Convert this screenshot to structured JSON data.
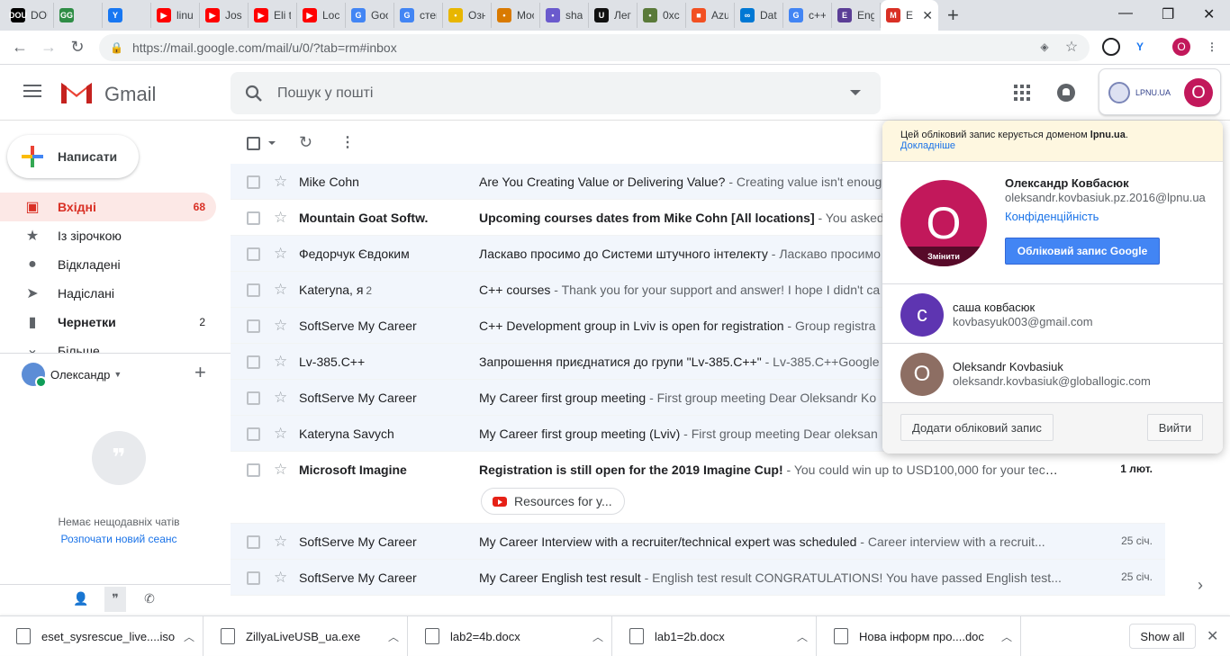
{
  "browser": {
    "tabs": [
      {
        "title": "DOU",
        "fav_color": "#000000",
        "fav_text": "DOU"
      },
      {
        "title": "",
        "fav_color": "#2f8d46",
        "fav_text": "GG"
      },
      {
        "title": "",
        "fav_color": "#1877f2",
        "fav_text": "Y"
      },
      {
        "title": "linux",
        "fav_color": "#ff0000",
        "fav_text": "▶"
      },
      {
        "title": "Jose",
        "fav_color": "#ff0000",
        "fav_text": "▶"
      },
      {
        "title": "Eli th",
        "fav_color": "#ff0000",
        "fav_text": "▶"
      },
      {
        "title": "Loca",
        "fav_color": "#ff0000",
        "fav_text": "▶"
      },
      {
        "title": "Goo",
        "fav_color": "#4285f4",
        "fav_text": "G"
      },
      {
        "title": "стек",
        "fav_color": "#4285f4",
        "fav_text": "G"
      },
      {
        "title": "Озн",
        "fav_color": "#e8b600",
        "fav_text": "•"
      },
      {
        "title": "Moc",
        "fav_color": "#d97a00",
        "fav_text": "•"
      },
      {
        "title": "shar",
        "fav_color": "#6a5acd",
        "fav_text": "•"
      },
      {
        "title": "Леге",
        "fav_color": "#111111",
        "fav_text": "U"
      },
      {
        "title": "0xc0",
        "fav_color": "#5a7a3a",
        "fav_text": "•"
      },
      {
        "title": "Azur",
        "fav_color": "#f25022",
        "fav_text": "■"
      },
      {
        "title": "Data",
        "fav_color": "#0078d4",
        "fav_text": "∞"
      },
      {
        "title": "c++",
        "fav_color": "#4285f4",
        "fav_text": "G"
      },
      {
        "title": "Engl",
        "fav_color": "#5b3e96",
        "fav_text": "E"
      }
    ],
    "active_tab": {
      "title": "E",
      "fav_color": "#d93025",
      "fav_text": "M"
    },
    "url": "https://mail.google.com/mail/u/0/?tab=rm#inbox",
    "profile_initial": "O"
  },
  "gmail": {
    "logo_text": "Gmail",
    "search_placeholder": "Пошук у пошті",
    "compose_label": "Написати",
    "nav": [
      {
        "label": "Вхідні",
        "count": "68",
        "icon": "inbox-icon",
        "glyph": "▣",
        "active": true,
        "bold": true
      },
      {
        "label": "Із зірочкою",
        "count": "",
        "icon": "star-icon",
        "glyph": "★",
        "active": false,
        "bold": false
      },
      {
        "label": "Відкладені",
        "count": "",
        "icon": "clock-icon",
        "glyph": "●",
        "active": false,
        "bold": false
      },
      {
        "label": "Надіслані",
        "count": "",
        "icon": "send-icon",
        "glyph": "➤",
        "active": false,
        "bold": false
      },
      {
        "label": "Чернетки",
        "count": "2",
        "icon": "draft-icon",
        "glyph": "▮",
        "active": false,
        "bold": true
      }
    ],
    "nav_more": "Більше",
    "hangouts": {
      "user": "Олександр",
      "empty_text": "Немає нещодавніх чатів",
      "new_session": "Розпочати новий сеанс"
    },
    "emails": [
      {
        "from": "Mike Cohn",
        "count": "",
        "subject": "Are You Creating Value or Delivering Value?",
        "snippet": " - Creating value isn't enough",
        "date": "",
        "unread": false,
        "chip": ""
      },
      {
        "from": "Mountain Goat Softw.",
        "count": "",
        "subject": "Upcoming courses dates from Mike Cohn [All locations]",
        "snippet": " - You asked to",
        "date": "",
        "unread": true,
        "chip": ""
      },
      {
        "from": "Федорчук Євдоким",
        "count": "",
        "subject": "Ласкаво просимо до Системи штучного інтелекту",
        "snippet": " - Ласкаво просимо",
        "date": "",
        "unread": false,
        "chip": ""
      },
      {
        "from": "Kateryna, я",
        "count": "2",
        "subject": "C++ courses",
        "snippet": " - Thank you for your support and answer! I hope I didn't ca",
        "date": "",
        "unread": false,
        "chip": ""
      },
      {
        "from": "SoftServe My Career",
        "count": "",
        "subject": "C++ Development group in Lviv is open for registration",
        "snippet": " - Group registra",
        "date": "",
        "unread": false,
        "chip": ""
      },
      {
        "from": "Lv-385.C++",
        "count": "",
        "subject": "Запрошення приєднатися до групи \"Lv-385.C++\"",
        "snippet": " - Lv-385.C++Google",
        "date": "",
        "unread": false,
        "chip": ""
      },
      {
        "from": "SoftServe My Career",
        "count": "",
        "subject": "My Career first group meeting",
        "snippet": " - First group meeting Dear Oleksandr Ko",
        "date": "",
        "unread": false,
        "chip": ""
      },
      {
        "from": "Kateryna Savych",
        "count": "",
        "subject": "My Career first group meeting (Lviv)",
        "snippet": " - First group meeting Dear oleksan",
        "date": "",
        "unread": false,
        "chip": ""
      },
      {
        "from": "Microsoft Imagine",
        "count": "",
        "subject": "Registration is still open for the 2019 Imagine Cup!",
        "snippet": " - You could win up to USD100,000 for your tech i...",
        "date": "1 лют.",
        "unread": true,
        "chip": "Resources for y..."
      },
      {
        "from": "SoftServe My Career",
        "count": "",
        "subject": "My Career Interview with a recruiter/technical expert was scheduled",
        "snippet": " - Career interview with a recruit...",
        "date": "25 січ.",
        "unread": false,
        "chip": ""
      },
      {
        "from": "SoftServe My Career",
        "count": "",
        "subject": "My Career English test result",
        "snippet": " - English test result CONGRATULATIONS! You have passed English test...",
        "date": "25 січ.",
        "unread": false,
        "chip": ""
      }
    ]
  },
  "account_popup": {
    "managed_text": "Цей обліковий запис керується доменом",
    "managed_domain": "lpnu.ua",
    "learn_more": "Докладніше",
    "avatar_initial": "O",
    "change_label": "Змінити",
    "name": "Олександр Ковбасюк",
    "email": "oleksandr.kovbasiuk.pz.2016@lpnu.ua",
    "privacy": "Конфіденційність",
    "google_account_button": "Обліковий запис Google",
    "others": [
      {
        "initial": "с",
        "name": "саша ковбасюк",
        "email": "kovbasyuk003@gmail.com",
        "color": "#5e35b1"
      },
      {
        "initial": "O",
        "name": "Oleksandr Kovbasiuk",
        "email": "oleksandr.kovbasiuk@globallogic.com",
        "color": "#8d6e63"
      }
    ],
    "add_account": "Додати обліковий запис",
    "logout": "Вийти",
    "org_logo_text": "LPNU.UA",
    "header_avatar": "O"
  },
  "downloads": {
    "items": [
      {
        "name": "eset_sysrescue_live....iso"
      },
      {
        "name": "ZillyaLiveUSB_ua.exe"
      },
      {
        "name": "lab2=4b.docx"
      },
      {
        "name": "lab1=2b.docx"
      },
      {
        "name": "Нова інформ про....doc"
      }
    ],
    "show_all": "Show all"
  }
}
